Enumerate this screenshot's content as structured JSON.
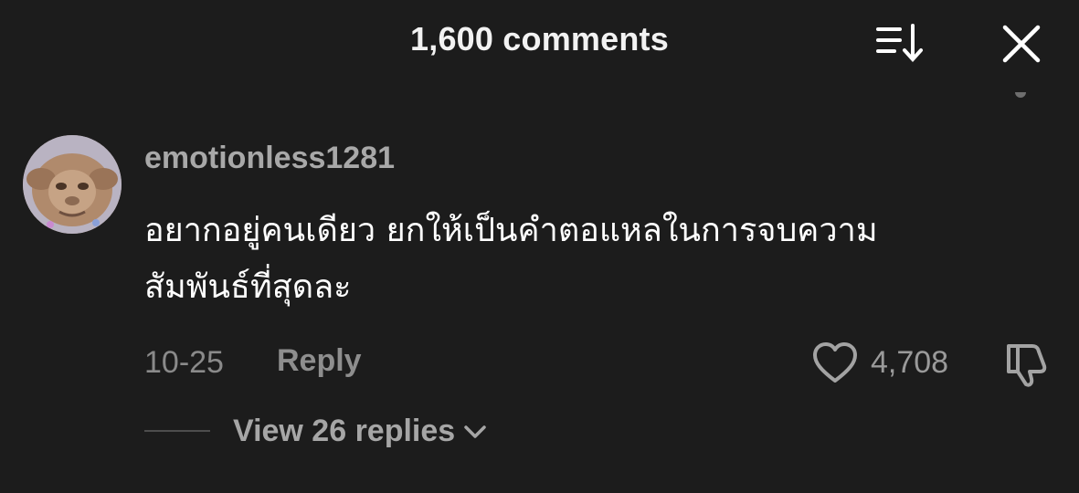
{
  "header": {
    "title": "1,600 comments",
    "sort_icon": "sort-descending-icon",
    "close_icon": "close-icon"
  },
  "comment": {
    "username": "emotionless1281",
    "text_line1": "อยากอยู่คนเดียว ยกให้เป็นคำตอแหลในการจบความ",
    "text_line2": "สัมพันธ์ที่สุดละ",
    "date": "10-25",
    "reply_label": "Reply",
    "like_icon": "heart-outline-icon",
    "like_count": "4,708",
    "dislike_icon": "thumbs-down-outline-icon",
    "view_replies_label": "View 26 replies",
    "view_replies_icon": "chevron-down-icon"
  },
  "colors": {
    "background": "#1c1c1c",
    "primary_text": "#ffffff",
    "secondary_text": "#a8a8a8",
    "muted_text": "#8a8a8a"
  }
}
